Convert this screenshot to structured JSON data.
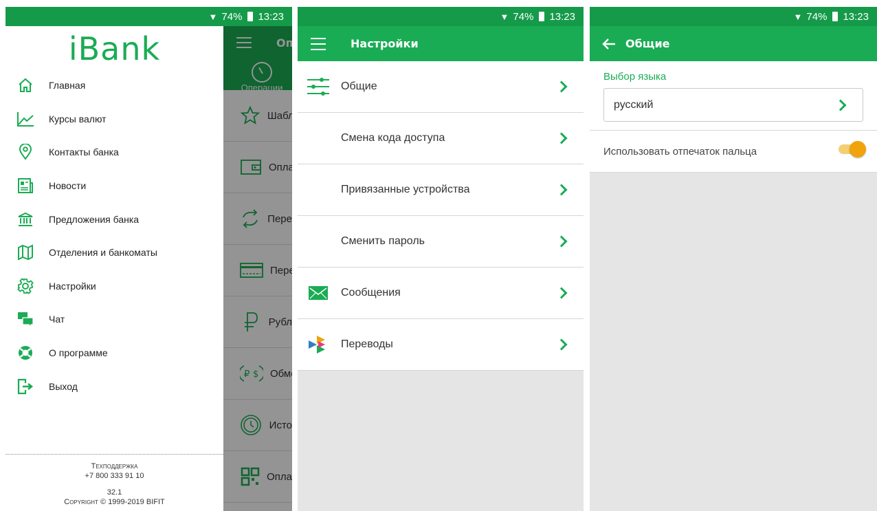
{
  "status": {
    "battery": "74%",
    "time": "13:23"
  },
  "drawer": {
    "logo": "iBank",
    "items": [
      {
        "label": "Главная",
        "icon": "home-icon"
      },
      {
        "label": "Курсы валют",
        "icon": "chart-line-icon"
      },
      {
        "label": "Контакты банка",
        "icon": "map-pin-icon"
      },
      {
        "label": "Новости",
        "icon": "newspaper-icon"
      },
      {
        "label": "Предложения банка",
        "icon": "bank-building-icon"
      },
      {
        "label": "Отделения и банкоматы",
        "icon": "map-icon"
      },
      {
        "label": "Настройки",
        "icon": "gear-icon"
      },
      {
        "label": "Чат",
        "icon": "chat-bubbles-icon"
      },
      {
        "label": "О программе",
        "icon": "lifebuoy-icon"
      },
      {
        "label": "Выход",
        "icon": "exit-icon"
      }
    ],
    "footer": {
      "support_label": "Техподдержка",
      "phone": "+7 800 333 91 10",
      "version": "32.1",
      "copyright": "Copyright © 1999-2019 BIFIT"
    }
  },
  "background_screen": {
    "title": "Оп",
    "tab_label": "Операции",
    "rows": [
      {
        "label": "Шабл",
        "icon": "star-template-icon"
      },
      {
        "label": "Опла",
        "icon": "wallet-icon"
      },
      {
        "label": "Пере",
        "icon": "transfer-arrows-icon"
      },
      {
        "label": "Пере",
        "icon": "card-icon"
      },
      {
        "label": "Рубл",
        "icon": "ruble-icon"
      },
      {
        "label": "Обме",
        "icon": "exchange-icon"
      },
      {
        "label": "Исто",
        "icon": "history-clock-icon"
      },
      {
        "label": "Опла",
        "icon": "qr-code-icon"
      }
    ]
  },
  "settings": {
    "title": "Настройки",
    "items": [
      {
        "label": "Общие",
        "icon": "sliders-icon"
      },
      {
        "label": "Смена кода доступа",
        "icon": ""
      },
      {
        "label": "Привязанные устройства",
        "icon": ""
      },
      {
        "label": "Сменить пароль",
        "icon": ""
      },
      {
        "label": "Сообщения",
        "icon": "envelope-icon"
      },
      {
        "label": "Переводы",
        "icon": "transfers-triangles-icon"
      }
    ]
  },
  "general": {
    "title": "Общие",
    "language_label": "Выбор языка",
    "language_value": "русский",
    "fingerprint_label": "Использовать отпечаток пальца",
    "fingerprint_enabled": true
  },
  "colors": {
    "primary": "#1aac54",
    "statusbar": "#159a4a",
    "toggle": "#f0a30a"
  }
}
